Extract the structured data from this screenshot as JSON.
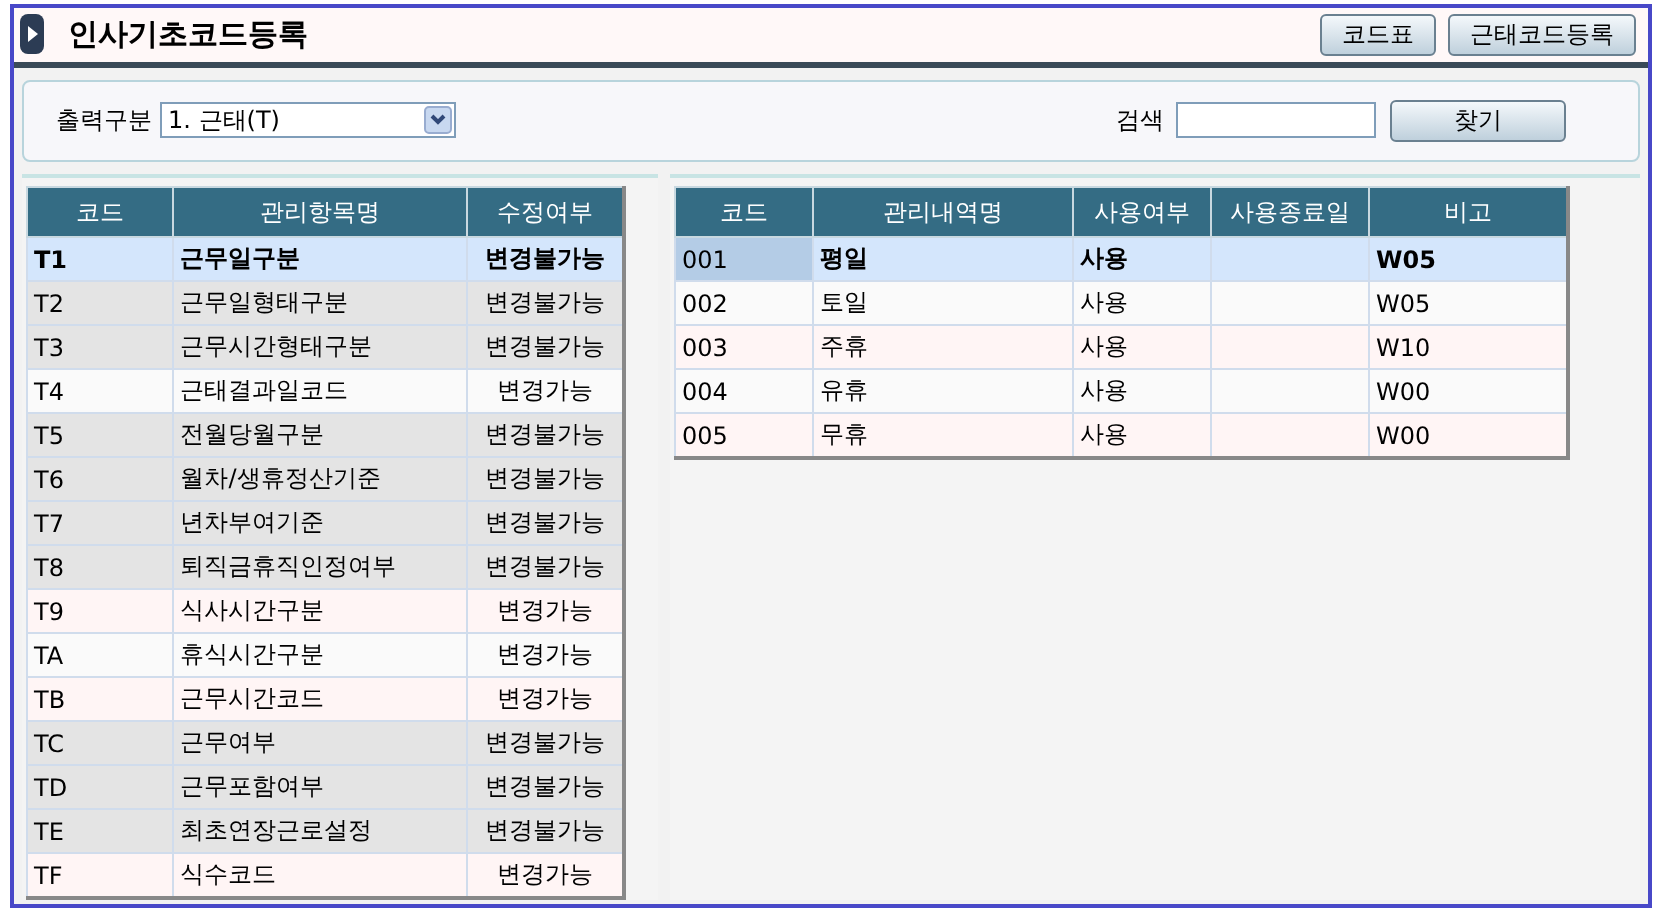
{
  "window": {
    "title": "인사기초코드등록"
  },
  "header_buttons": [
    "코드표",
    "근태코드등록"
  ],
  "filter": {
    "label": "출력구분",
    "value": "1. 근태(T)"
  },
  "search": {
    "label": "검색",
    "button": "찾기"
  },
  "left_table": {
    "columns": [
      "코드",
      "관리항목명",
      "수정여부"
    ],
    "rows": [
      {
        "cells": [
          "T1",
          "근무일구분",
          "변경불가능"
        ],
        "editable": false,
        "selected": true
      },
      {
        "cells": [
          "T2",
          "근무일형태구분",
          "변경불가능"
        ],
        "editable": false,
        "selected": false
      },
      {
        "cells": [
          "T3",
          "근무시간형태구분",
          "변경불가능"
        ],
        "editable": false,
        "selected": false
      },
      {
        "cells": [
          "T4",
          "근태결과일코드",
          "변경가능"
        ],
        "editable": true,
        "selected": false
      },
      {
        "cells": [
          "T5",
          "전월당월구분",
          "변경불가능"
        ],
        "editable": false,
        "selected": false
      },
      {
        "cells": [
          "T6",
          "월차/생휴정산기준",
          "변경불가능"
        ],
        "editable": false,
        "selected": false
      },
      {
        "cells": [
          "T7",
          "년차부여기준",
          "변경불가능"
        ],
        "editable": false,
        "selected": false
      },
      {
        "cells": [
          "T8",
          "퇴직금휴직인정여부",
          "변경불가능"
        ],
        "editable": false,
        "selected": false
      },
      {
        "cells": [
          "T9",
          "식사시간구분",
          "변경가능"
        ],
        "editable": true,
        "selected": false
      },
      {
        "cells": [
          "TA",
          "휴식시간구분",
          "변경가능"
        ],
        "editable": true,
        "selected": false
      },
      {
        "cells": [
          "TB",
          "근무시간코드",
          "변경가능"
        ],
        "editable": true,
        "selected": false
      },
      {
        "cells": [
          "TC",
          "근무여부",
          "변경불가능"
        ],
        "editable": false,
        "selected": false
      },
      {
        "cells": [
          "TD",
          "근무포함여부",
          "변경불가능"
        ],
        "editable": false,
        "selected": false
      },
      {
        "cells": [
          "TE",
          "최초연장근로설정",
          "변경불가능"
        ],
        "editable": false,
        "selected": false
      },
      {
        "cells": [
          "TF",
          "식수코드",
          "변경가능"
        ],
        "editable": true,
        "selected": false
      }
    ]
  },
  "right_table": {
    "columns": [
      "코드",
      "관리내역명",
      "사용여부",
      "사용종료일",
      "비고"
    ],
    "rows": [
      {
        "cells": [
          "001",
          "평일",
          "사용",
          null,
          "W05"
        ],
        "selected": true
      },
      {
        "cells": [
          "002",
          "토일",
          "사용",
          null,
          "W05"
        ],
        "selected": false
      },
      {
        "cells": [
          "003",
          "주휴",
          "사용",
          null,
          "W10"
        ],
        "selected": false
      },
      {
        "cells": [
          "004",
          "유휴",
          "사용",
          null,
          "W00"
        ],
        "selected": false
      },
      {
        "cells": [
          "005",
          "무휴",
          "사용",
          null,
          "W00"
        ],
        "selected": false
      }
    ]
  }
}
